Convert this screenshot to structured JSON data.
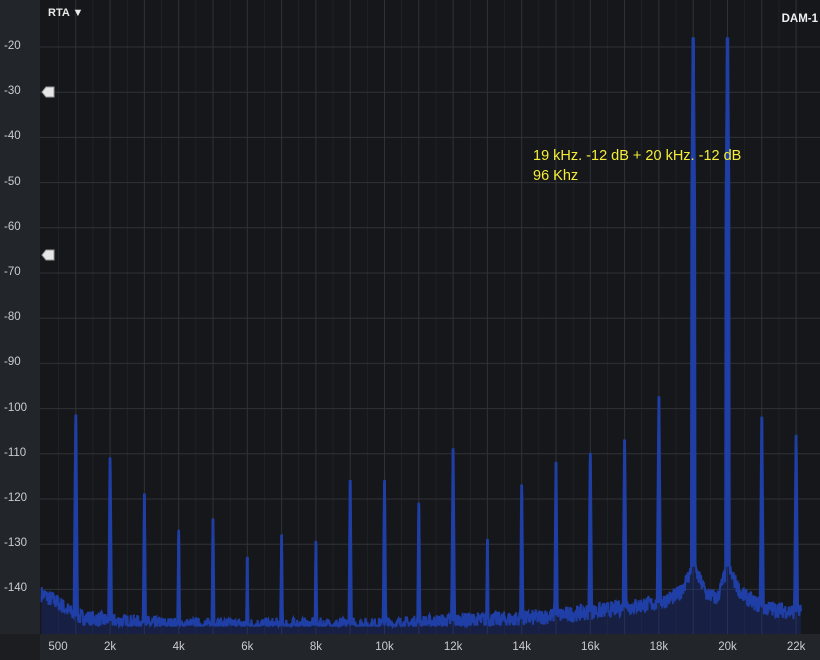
{
  "toolbar": {
    "mode_label": "RTA ▼",
    "device_label": "DAM-1"
  },
  "annotation": {
    "line1": "19 kHz. -12 dB + 20 kHz. -12 dB",
    "line2": "96 Khz"
  },
  "colors": {
    "background": "#16171a",
    "grid": "#2f3238",
    "trace": "#1f3fa6",
    "trace_fill": "#1a3190",
    "annotation": "#f4ee3a"
  },
  "markers": [
    {
      "name": "upper-level-marker",
      "level_db": -30
    },
    {
      "name": "lower-level-marker",
      "level_db": -66
    }
  ],
  "chart_data": {
    "type": "line",
    "title": "",
    "xlabel": "",
    "ylabel": "",
    "x_tick_labels": [
      "500",
      "2k",
      "4k",
      "6k",
      "8k",
      "10k",
      "12k",
      "14k",
      "16k",
      "18k",
      "20k",
      "22k"
    ],
    "x_tick_values": [
      500,
      2000,
      4000,
      6000,
      8000,
      10000,
      12000,
      14000,
      16000,
      18000,
      20000,
      22000
    ],
    "y_tick_labels": [
      "-20",
      "-30",
      "-40",
      "-50",
      "-60",
      "-70",
      "-80",
      "-90",
      "-100",
      "-110",
      "-120",
      "-130",
      "-140"
    ],
    "y_tick_values": [
      -20,
      -30,
      -40,
      -50,
      -60,
      -70,
      -80,
      -90,
      -100,
      -110,
      -120,
      -130,
      -140
    ],
    "xlim": [
      0,
      22300
    ],
    "ylim": [
      -148,
      -17
    ],
    "grid": true,
    "series": [
      {
        "noise_floor": [
          [
            0,
            -141
          ],
          [
            500,
            -143
          ],
          [
            1000,
            -146
          ],
          [
            2000,
            -147
          ],
          [
            4000,
            -148
          ],
          [
            6000,
            -148
          ],
          [
            8000,
            -148
          ],
          [
            10000,
            -148
          ],
          [
            12000,
            -147
          ],
          [
            14000,
            -146.5
          ],
          [
            16000,
            -145
          ],
          [
            17000,
            -144
          ],
          [
            18000,
            -143
          ],
          [
            18600,
            -141
          ],
          [
            19000,
            -135
          ],
          [
            19400,
            -141
          ],
          [
            19700,
            -142
          ],
          [
            20000,
            -135
          ],
          [
            20400,
            -141
          ],
          [
            21000,
            -144
          ],
          [
            22000,
            -145
          ]
        ],
        "peaks": [
          {
            "freq": 1000,
            "db": -101.5
          },
          {
            "freq": 2000,
            "db": -111
          },
          {
            "freq": 3000,
            "db": -119
          },
          {
            "freq": 4000,
            "db": -127
          },
          {
            "freq": 5000,
            "db": -124.5
          },
          {
            "freq": 6000,
            "db": -133
          },
          {
            "freq": 7000,
            "db": -128
          },
          {
            "freq": 8000,
            "db": -129.5
          },
          {
            "freq": 9000,
            "db": -116
          },
          {
            "freq": 10000,
            "db": -116
          },
          {
            "freq": 11000,
            "db": -121
          },
          {
            "freq": 12000,
            "db": -109
          },
          {
            "freq": 13000,
            "db": -129
          },
          {
            "freq": 14000,
            "db": -117
          },
          {
            "freq": 15000,
            "db": -112
          },
          {
            "freq": 16000,
            "db": -110
          },
          {
            "freq": 17000,
            "db": -107
          },
          {
            "freq": 18000,
            "db": -97.5
          },
          {
            "freq": 19000,
            "db": -18
          },
          {
            "freq": 20000,
            "db": -18
          },
          {
            "freq": 21000,
            "db": -102
          },
          {
            "freq": 22000,
            "db": -106
          }
        ]
      }
    ]
  }
}
